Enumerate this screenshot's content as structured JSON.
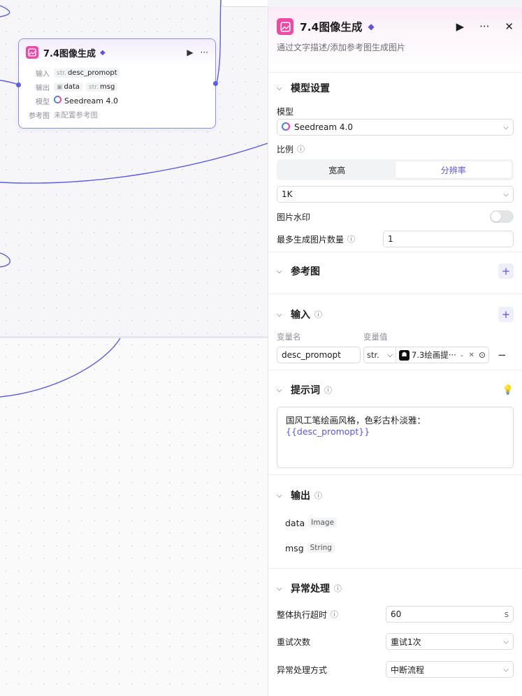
{
  "node": {
    "title": "7.4图像生成",
    "rows": {
      "input_label": "输入",
      "input_tag_type": "str.",
      "input_tag_name": "desc_promopt",
      "output_label": "输出",
      "output_tag1_name": "data",
      "output_tag2_type": "str.",
      "output_tag2_name": "msg",
      "model_label": "模型",
      "model_value": "Seedream 4.0",
      "ref_label": "参考图",
      "ref_value": "未配置参考图"
    }
  },
  "panel": {
    "title": "7.4图像生成",
    "description": "通过文字描述/添加参考图生成图片",
    "model_settings": {
      "title": "模型设置",
      "model_label": "模型",
      "model_value": "Seedream 4.0",
      "ratio_label": "比例",
      "seg_options": [
        "宽高",
        "分辨率"
      ],
      "seg_active_index": 1,
      "resolution_value": "1K",
      "watermark_label": "图片水印",
      "watermark_on": false,
      "max_count_label": "最多生成图片数量",
      "max_count_value": "1"
    },
    "reference": {
      "title": "参考图"
    },
    "inputs": {
      "title": "输入",
      "col_name": "变量名",
      "col_value": "变量值",
      "var_name": "desc_promopt",
      "var_type": "str.",
      "ref_node": "7.3绘画提···",
      "ref_dash": "-"
    },
    "prompt": {
      "title": "提示词",
      "text_prefix": "国风工笔绘画风格，色彩古朴淡雅：",
      "text_var": "{{desc_promopt}}"
    },
    "outputs": {
      "title": "输出",
      "items": [
        {
          "name": "data",
          "type": "Image"
        },
        {
          "name": "msg",
          "type": "String"
        }
      ]
    },
    "error_handling": {
      "title": "异常处理",
      "timeout_label": "整体执行超时",
      "timeout_value": "60",
      "timeout_unit": "s",
      "retry_label": "重试次数",
      "retry_value": "重试1次",
      "mode_label": "异常处理方式",
      "mode_value": "中断流程"
    }
  },
  "colors": {
    "accent": "#5a55e6",
    "brand_pink": "#ef49a5",
    "edge": "#5d5ee8"
  }
}
